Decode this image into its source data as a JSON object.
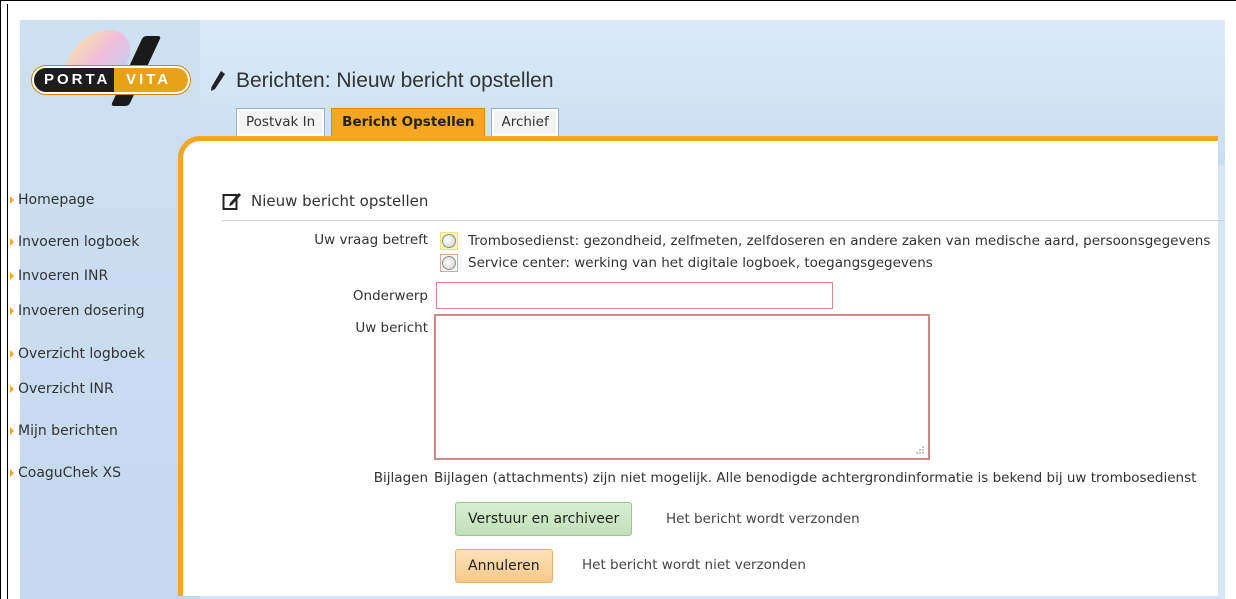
{
  "brand": {
    "logo_left": "PORTA",
    "logo_right": "VITA"
  },
  "header": {
    "title": "Berichten: Nieuw bericht opstellen"
  },
  "tabs": [
    {
      "label": "Postvak In",
      "active": false
    },
    {
      "label": "Bericht Opstellen",
      "active": true
    },
    {
      "label": "Archief",
      "active": false
    }
  ],
  "sidebar": {
    "items": [
      {
        "label": "Homepage"
      },
      {
        "label": "Invoeren logboek"
      },
      {
        "label": "Invoeren INR"
      },
      {
        "label": "Invoeren dosering"
      },
      {
        "label": "Overzicht logboek"
      },
      {
        "label": "Overzicht INR"
      },
      {
        "label": "Mijn berichten"
      },
      {
        "label": "CoaguChek XS"
      }
    ]
  },
  "form": {
    "section_title": "Nieuw bericht opstellen",
    "topic_label": "Uw vraag betreft",
    "topic_options": [
      {
        "label": "Trombosedienst: gezondheid, zelfmeten, zelfdoseren en andere zaken van medische aard, persoonsgegevens"
      },
      {
        "label": "Service center: werking van het digitale logboek, toegangsgegevens"
      }
    ],
    "subject_label": "Onderwerp",
    "subject_value": "",
    "message_label": "Uw bericht",
    "message_value": "",
    "attachments_label": "Bijlagen",
    "attachments_text": "Bijlagen (attachments) zijn niet mogelijk. Alle benodigde achtergrondinformatie is bekend bij uw trombosedienst",
    "send_button": "Verstuur en archiveer",
    "send_hint": "Het bericht wordt verzonden",
    "cancel_button": "Annuleren",
    "cancel_hint": "Het bericht wordt niet verzonden"
  },
  "colors": {
    "accent": "#f5a623",
    "sidebar_bg": "#cfe0f3",
    "send_button": "#c9e6c0",
    "cancel_button": "#fbd59e"
  }
}
